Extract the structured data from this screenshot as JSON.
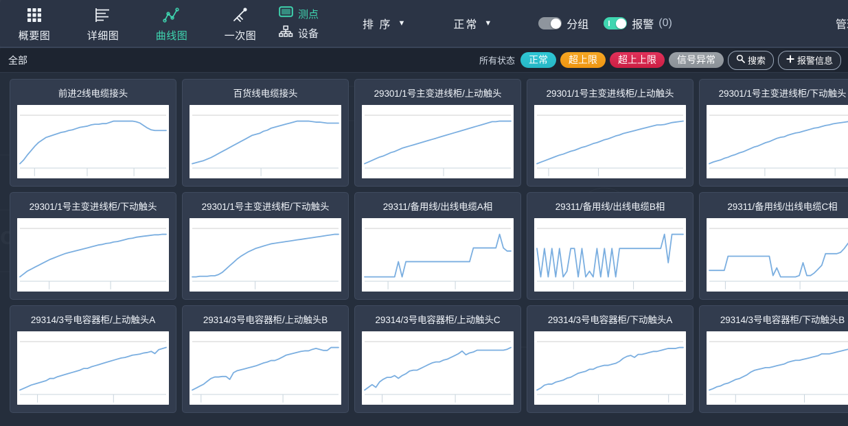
{
  "nav": {
    "items": [
      {
        "label": "概要图",
        "icon": "grid-icon",
        "active": false
      },
      {
        "label": "详细图",
        "icon": "bar-list-icon",
        "active": false
      },
      {
        "label": "曲线图",
        "icon": "line-chart-icon",
        "active": true
      },
      {
        "label": "一次图",
        "icon": "sensor-icon",
        "active": false
      }
    ],
    "stack": [
      {
        "label": "测点",
        "icon": "screen-icon",
        "active": true
      },
      {
        "label": "设备",
        "icon": "sitemap-icon",
        "active": false
      }
    ],
    "dropdowns": [
      {
        "label": "排 序",
        "caret": "▼"
      },
      {
        "label": "正常",
        "caret": "▼"
      }
    ],
    "toggles": [
      {
        "label": "分组",
        "state": "on",
        "color": "#8e959d"
      },
      {
        "label": "报警",
        "suffix": "(0)",
        "state": "on",
        "color": "#3fd6b0"
      }
    ],
    "admin": "管理"
  },
  "filterbar": {
    "all_label": "全部",
    "status_label": "所有状态",
    "chips": [
      {
        "label": "正常",
        "color": "#2fc7d4"
      },
      {
        "label": "超上限",
        "color": "#f5a623"
      },
      {
        "label": "超上上限",
        "color": "#e0315a"
      },
      {
        "label": "信号异常",
        "color": "#9aa0a6"
      }
    ],
    "search_button": "搜索",
    "search_icon": "search-icon",
    "alarm_button": "报警信息",
    "alarm_icon": "plus-icon"
  },
  "cards": [
    {
      "title": "前进2线电缆接头",
      "series": [
        4,
        10,
        18,
        25,
        32,
        38,
        42,
        46,
        48,
        50,
        52,
        54,
        55,
        57,
        58,
        60,
        62,
        63,
        64,
        66,
        67,
        67,
        68,
        68,
        70,
        72,
        72,
        72,
        72,
        72,
        72,
        71,
        69,
        65,
        61,
        58,
        57,
        57,
        57,
        57
      ],
      "ticks": [
        0.1,
        0.46,
        0.78
      ]
    },
    {
      "title": "百货线电缆接头",
      "series": [
        6,
        8,
        10,
        12,
        15,
        18,
        22,
        26,
        30,
        34,
        38,
        42,
        46,
        50,
        54,
        58,
        62,
        64,
        66,
        70,
        72,
        76,
        78,
        80,
        82,
        84,
        86,
        88,
        90,
        90,
        90,
        90,
        89,
        88,
        88,
        87,
        86,
        86,
        86,
        86
      ],
      "ticks": [
        0.47
      ]
    },
    {
      "title": "29301/1号主变进线柜/上动触头",
      "series": [
        4,
        7,
        10,
        13,
        16,
        18,
        21,
        24,
        26,
        29,
        32,
        34,
        36,
        38,
        40,
        42,
        44,
        46,
        48,
        50,
        52,
        54,
        56,
        58,
        60,
        62,
        64,
        66,
        68,
        70,
        72,
        74,
        76,
        78,
        80,
        80,
        81,
        81,
        81,
        81
      ],
      "ticks": [
        0.54
      ]
    },
    {
      "title": "29301/1号主变进线柜/上动触头",
      "series": [
        6,
        9,
        12,
        15,
        18,
        21,
        24,
        26,
        29,
        32,
        34,
        37,
        40,
        42,
        45,
        48,
        50,
        53,
        56,
        58,
        61,
        64,
        66,
        69,
        71,
        73,
        75,
        77,
        79,
        81,
        83,
        85,
        87,
        87,
        88,
        90,
        92,
        93,
        94,
        95
      ],
      "ticks": [
        0.08,
        0.42
      ]
    },
    {
      "title": "29301/1号主变进线柜/下动触头",
      "series": [
        5,
        8,
        10,
        12,
        15,
        17,
        20,
        22,
        25,
        27,
        30,
        33,
        36,
        38,
        41,
        44,
        46,
        49,
        52,
        54,
        55,
        58,
        60,
        62,
        63,
        65,
        67,
        69,
        71,
        72,
        74,
        76,
        77,
        79,
        80,
        81,
        82,
        83,
        84,
        84
      ],
      "ticks": [
        0.38,
        0.86
      ]
    },
    {
      "title": "29301/1号主变进线柜/下动触头",
      "series": [
        4,
        10,
        16,
        20,
        24,
        28,
        32,
        36,
        40,
        43,
        46,
        49,
        52,
        54,
        56,
        58,
        60,
        62,
        64,
        66,
        68,
        70,
        71,
        73,
        74,
        76,
        77,
        79,
        81,
        83,
        84,
        86,
        87,
        88,
        89,
        90,
        91,
        91,
        92,
        92
      ],
      "ticks": [
        0.2,
        0.62
      ]
    },
    {
      "title": "29301/1号主变进线柜/下动触头",
      "series": [
        6,
        6,
        7,
        7,
        7,
        8,
        8,
        10,
        14,
        20,
        26,
        32,
        38,
        43,
        47,
        51,
        54,
        57,
        59,
        61,
        63,
        65,
        66,
        67,
        68,
        69,
        70,
        71,
        72,
        73,
        74,
        75,
        76,
        77,
        78,
        79,
        80,
        81,
        82,
        82
      ],
      "ticks": [
        0.43
      ]
    },
    {
      "title": "29311/备用线/出线电缆A相",
      "series": [
        18,
        18,
        18,
        18,
        18,
        18,
        18,
        18,
        18,
        38,
        18,
        38,
        38,
        38,
        38,
        38,
        38,
        38,
        38,
        38,
        38,
        38,
        38,
        38,
        38,
        38,
        38,
        38,
        38,
        56,
        56,
        56,
        56,
        56,
        56,
        56,
        74,
        56,
        52,
        52
      ],
      "ticks": [
        0.16,
        0.62
      ]
    },
    {
      "title": "29311/备用线/出线电缆B相",
      "series": [
        62,
        22,
        62,
        22,
        62,
        22,
        62,
        22,
        30,
        62,
        62,
        22,
        62,
        22,
        30,
        22,
        62,
        22,
        62,
        22,
        62,
        22,
        62,
        62,
        62,
        62,
        62,
        62,
        62,
        62,
        62,
        62,
        62,
        62,
        82,
        42,
        82,
        82,
        82,
        82
      ],
      "ticks": [
        0.25,
        0.66
      ]
    },
    {
      "title": "29311/备用线/出线电缆C相",
      "series": [
        30,
        30,
        30,
        30,
        30,
        52,
        52,
        52,
        52,
        52,
        52,
        52,
        52,
        52,
        52,
        52,
        52,
        22,
        34,
        20,
        20,
        20,
        20,
        20,
        22,
        42,
        22,
        22,
        26,
        32,
        38,
        56,
        56,
        56,
        56,
        58,
        64,
        72,
        78,
        86
      ],
      "ticks": [
        0.11,
        0.62
      ]
    },
    {
      "title": "29314/3号电容器柜/上动触头A",
      "series": [
        5,
        8,
        11,
        14,
        16,
        18,
        20,
        22,
        26,
        26,
        29,
        31,
        33,
        35,
        37,
        39,
        41,
        44,
        44,
        47,
        49,
        51,
        53,
        55,
        57,
        59,
        61,
        63,
        64,
        66,
        68,
        69,
        70,
        72,
        73,
        75,
        71,
        78,
        80,
        82
      ],
      "ticks": [
        0.12,
        0.64
      ]
    },
    {
      "title": "29314/3号电容器柜/上动触头B",
      "series": [
        4,
        8,
        12,
        16,
        22,
        28,
        31,
        31,
        32,
        32,
        26,
        40,
        44,
        46,
        48,
        50,
        52,
        54,
        57,
        60,
        62,
        65,
        65,
        68,
        72,
        76,
        78,
        80,
        82,
        84,
        85,
        85,
        88,
        90,
        88,
        86,
        86,
        92,
        92,
        92
      ],
      "ticks": [
        0.06,
        0.62
      ]
    },
    {
      "title": "29314/3号电容器柜/上动触头C",
      "series": [
        8,
        14,
        20,
        14,
        26,
        32,
        36,
        36,
        40,
        34,
        40,
        44,
        50,
        52,
        52,
        56,
        60,
        64,
        68,
        70,
        70,
        74,
        76,
        80,
        84,
        88,
        94,
        86,
        90,
        92,
        96,
        96,
        96,
        96,
        96,
        96,
        96,
        96,
        98,
        102
      ],
      "ticks": [
        0.12,
        0.62
      ]
    },
    {
      "title": "29314/3号电容器柜/下动触头A",
      "series": [
        4,
        8,
        14,
        16,
        16,
        20,
        22,
        24,
        28,
        30,
        34,
        38,
        40,
        42,
        46,
        46,
        50,
        52,
        54,
        54,
        56,
        58,
        62,
        68,
        72,
        74,
        70,
        76,
        76,
        78,
        80,
        82,
        82,
        84,
        86,
        88,
        88,
        88,
        90,
        90
      ],
      "ticks": [
        0.42,
        0.9
      ]
    },
    {
      "title": "29314/3号电容器柜/下动触头B",
      "series": [
        5,
        8,
        12,
        14,
        18,
        20,
        24,
        28,
        30,
        34,
        38,
        44,
        48,
        50,
        52,
        54,
        54,
        56,
        58,
        60,
        62,
        66,
        68,
        70,
        70,
        72,
        74,
        76,
        78,
        80,
        84,
        84,
        84,
        86,
        88,
        90,
        92,
        94,
        96,
        98
      ],
      "ticks": [
        0.18,
        0.65
      ]
    }
  ],
  "chart_style": {
    "line_color": "#7aaee0",
    "top_rule_color": "#cfcfcf",
    "axis_color": "#c8d4dd",
    "background": "#ffffff"
  }
}
